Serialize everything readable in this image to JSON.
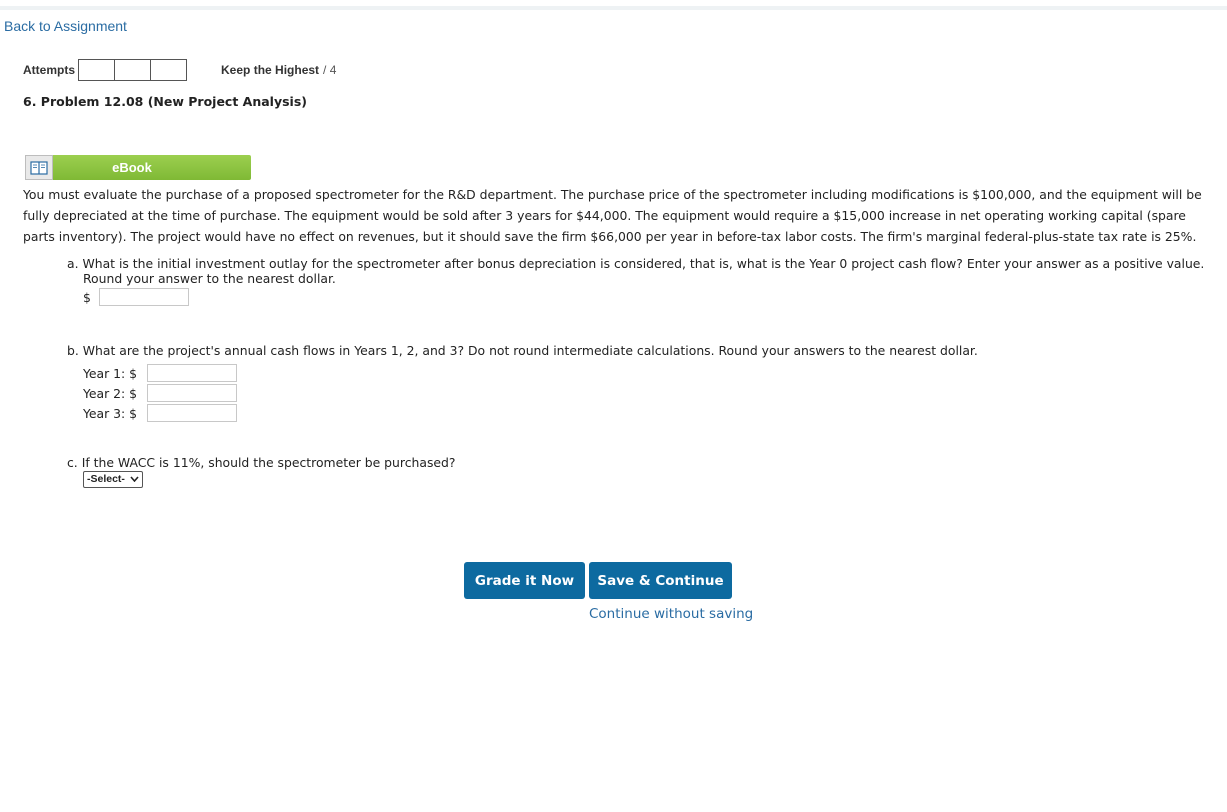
{
  "nav": {
    "back_label": "Back to Assignment"
  },
  "attempts": {
    "label": "Attempts",
    "keep_label": "Keep the Highest",
    "keep_count": "/ 4"
  },
  "problem": {
    "title": "6.  Problem 12.08 (New Project Analysis)"
  },
  "ebook": {
    "label": "eBook"
  },
  "intro": "You must evaluate the purchase of a proposed spectrometer for the R&D department. The purchase price of the spectrometer including modifications is $100,000, and the equipment will be fully depreciated at the time of purchase. The equipment would be sold after 3 years for $44,000. The equipment would require a $15,000 increase in net operating working capital (spare parts inventory). The project would have no effect on revenues, but it should save the firm $66,000 per year in before-tax labor costs. The firm's marginal federal-plus-state tax rate is 25%.",
  "part_a": {
    "question": "a. What is the initial investment outlay for the spectrometer after bonus depreciation is considered, that is, what is the Year 0 project cash flow? Enter your answer as a positive value. Round your answer to the nearest dollar.",
    "currency": "$",
    "value": ""
  },
  "part_b": {
    "question": "b. What are the project's annual cash flows in Years 1, 2, and 3? Do not round intermediate calculations. Round your answers to the nearest dollar.",
    "rows": [
      {
        "label": "Year 1: $",
        "value": ""
      },
      {
        "label": "Year 2: $",
        "value": ""
      },
      {
        "label": "Year 3: $",
        "value": ""
      }
    ]
  },
  "part_c": {
    "question": "c. If the WACC is 11%, should the spectrometer be purchased?",
    "select_value": "-Select-"
  },
  "buttons": {
    "grade": "Grade it Now",
    "save": "Save & Continue",
    "continue": "Continue without saving"
  },
  "colors": {
    "link": "#2a6ca3",
    "button": "#0d6aa0",
    "ebook": "#8cc63f"
  },
  "icons": {
    "ebook": "book-icon",
    "select": "chevron-down-icon"
  }
}
